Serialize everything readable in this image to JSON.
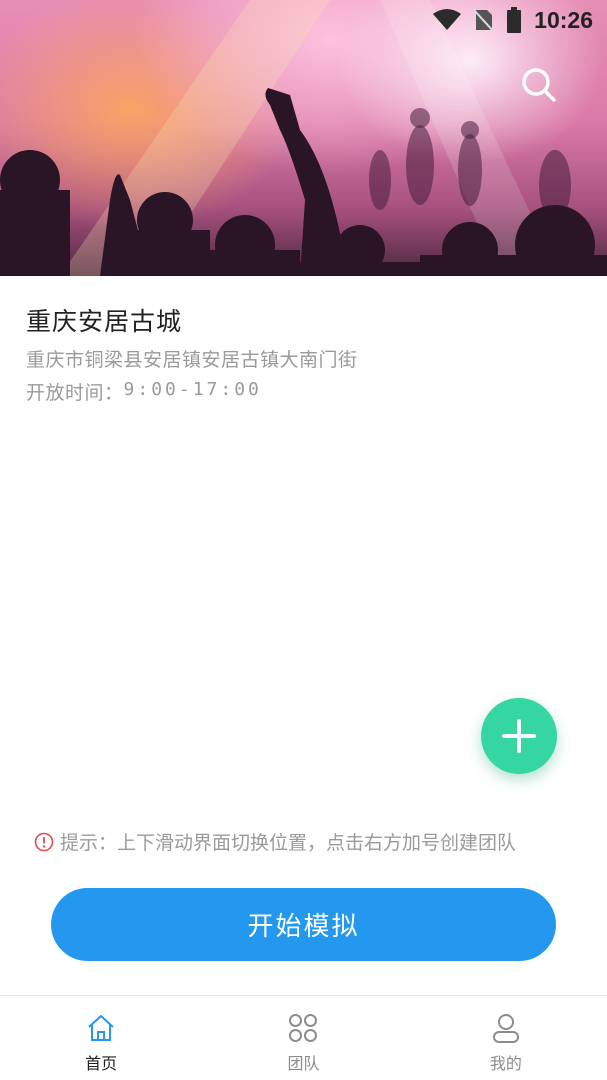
{
  "status_bar": {
    "time": "10:26",
    "icons": [
      "wifi-icon",
      "no-sim-icon",
      "battery-icon"
    ]
  },
  "header": {
    "search_icon": "search-icon"
  },
  "place": {
    "title": "重庆安居古城",
    "address": "重庆市铜梁县安居镇安居古镇大南门街",
    "hours_label": "开放时间：",
    "hours_value": "9:00-17:00"
  },
  "fab": {
    "icon": "plus-icon",
    "color": "#35d6a1"
  },
  "tip": {
    "icon": "alert-icon",
    "text": "提示：上下滑动界面切换位置，点击右方加号创建团队",
    "icon_color": "#e84d4d"
  },
  "start_button": {
    "label": "开始模拟",
    "color": "#2497ee"
  },
  "bottom_nav": {
    "items": [
      {
        "label": "首页",
        "icon": "home-icon",
        "active": true
      },
      {
        "label": "团队",
        "icon": "team-icon",
        "active": false
      },
      {
        "label": "我的",
        "icon": "profile-icon",
        "active": false
      }
    ],
    "active_color": "#2497ee"
  }
}
